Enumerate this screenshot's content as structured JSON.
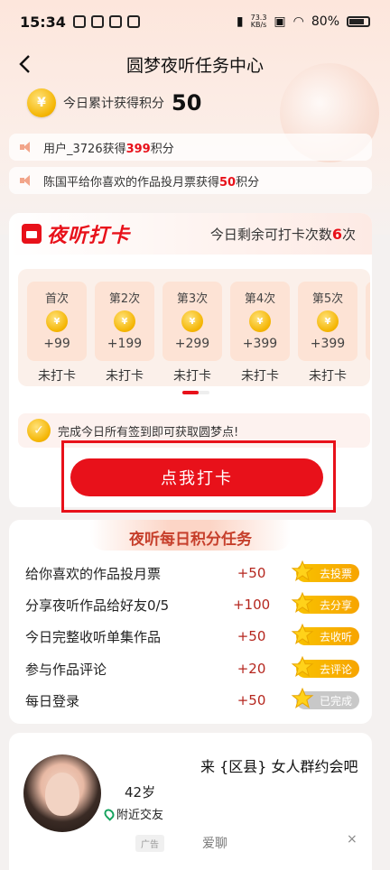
{
  "status_bar": {
    "time": "15:34",
    "net_rate_value": "73.3",
    "net_rate_unit": "KB/s",
    "battery": "80%"
  },
  "header": {
    "title": "圆梦夜听任务中心"
  },
  "points": {
    "label": "今日累计获得积分",
    "value": "50"
  },
  "tickers": [
    {
      "prefix": "用户_3726获得",
      "number": "399",
      "suffix": "积分"
    },
    {
      "prefix": "陈国平给你喜欢的作品投月票获得",
      "number": "50",
      "suffix": "积分"
    }
  ],
  "checkin": {
    "logo_text": "夜听打卡",
    "remaining_prefix": "今日剩余可打卡次数",
    "remaining_count": "6",
    "days": [
      {
        "title": "首次",
        "points": "+99",
        "status": "未打卡"
      },
      {
        "title": "第2次",
        "points": "+199",
        "status": "未打卡"
      },
      {
        "title": "第3次",
        "points": "+299",
        "status": "未打卡"
      },
      {
        "title": "第4次",
        "points": "+399",
        "status": "未打卡"
      },
      {
        "title": "第5次",
        "points": "+399",
        "status": "未打卡"
      },
      {
        "title": "第",
        "points": "",
        "status": "未"
      }
    ],
    "tip": "完成今日所有签到即可获取圆梦点!",
    "cta": "点我打卡"
  },
  "tasks": {
    "title": "夜听每日积分任务",
    "items": [
      {
        "name": "给你喜欢的作品投月票",
        "points": "+50",
        "action": "去投票",
        "done": false
      },
      {
        "name": "分享夜听作品给好友0/5",
        "points": "+100",
        "action": "去分享",
        "done": false
      },
      {
        "name": "今日完整收听单集作品",
        "points": "+50",
        "action": "去收听",
        "done": false
      },
      {
        "name": "参与作品评论",
        "points": "+20",
        "action": "去评论",
        "done": false
      },
      {
        "name": "每日登录",
        "points": "+50",
        "action": "已完成",
        "done": true
      }
    ]
  },
  "ad": {
    "title": "来 {区县} 女人群约会吧",
    "age": "42岁",
    "location": "附近交友",
    "tag": "广告",
    "app_name": "爱聊",
    "close": "×"
  },
  "colors": {
    "accent": "#e8111a",
    "gold": "#f4b400",
    "task_points": "#b5261e"
  }
}
